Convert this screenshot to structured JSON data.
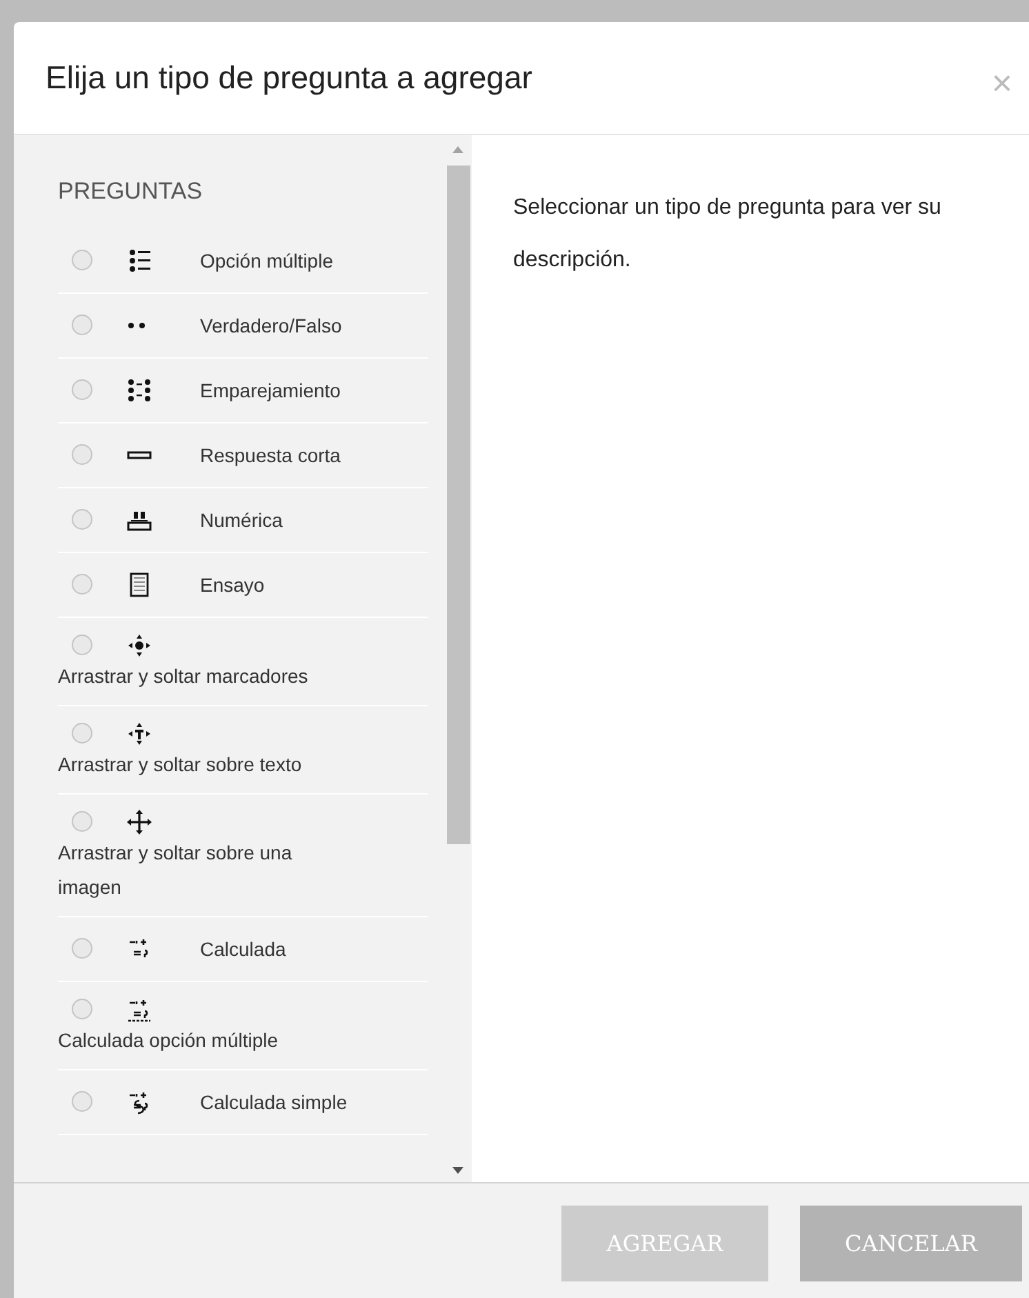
{
  "dialog": {
    "title": "Elija un tipo de pregunta a agregar",
    "close": "×"
  },
  "list": {
    "heading": "PREGUNTAS",
    "items": [
      {
        "label": "Opción múltiple",
        "kind": "inline",
        "selected": false
      },
      {
        "label": "Verdadero/Falso",
        "kind": "inline",
        "selected": false
      },
      {
        "label": "Emparejamiento",
        "kind": "inline",
        "selected": false
      },
      {
        "label": "Respuesta corta",
        "kind": "inline",
        "selected": false
      },
      {
        "label": "Numérica",
        "kind": "inline",
        "selected": false
      },
      {
        "label": "Ensayo",
        "kind": "inline",
        "selected": false
      },
      {
        "label": "Arrastrar y soltar marcadores",
        "kind": "stacked",
        "selected": false
      },
      {
        "label": "Arrastrar y soltar sobre texto",
        "kind": "stacked",
        "selected": false
      },
      {
        "label": "Arrastrar y soltar sobre una imagen",
        "kind": "stacked",
        "selected": false
      },
      {
        "label": "Calculada",
        "kind": "inline",
        "selected": false
      },
      {
        "label": "Calculada opción múltiple",
        "kind": "stacked",
        "selected": false
      },
      {
        "label": "Calculada simple",
        "kind": "inline",
        "selected": false
      }
    ]
  },
  "description": "Seleccionar un tipo de pregunta para ver su descripción.",
  "buttons": [
    {
      "label": "AGREGAR",
      "disabled": true
    },
    {
      "label": "CANCELAR",
      "disabled": false
    }
  ]
}
